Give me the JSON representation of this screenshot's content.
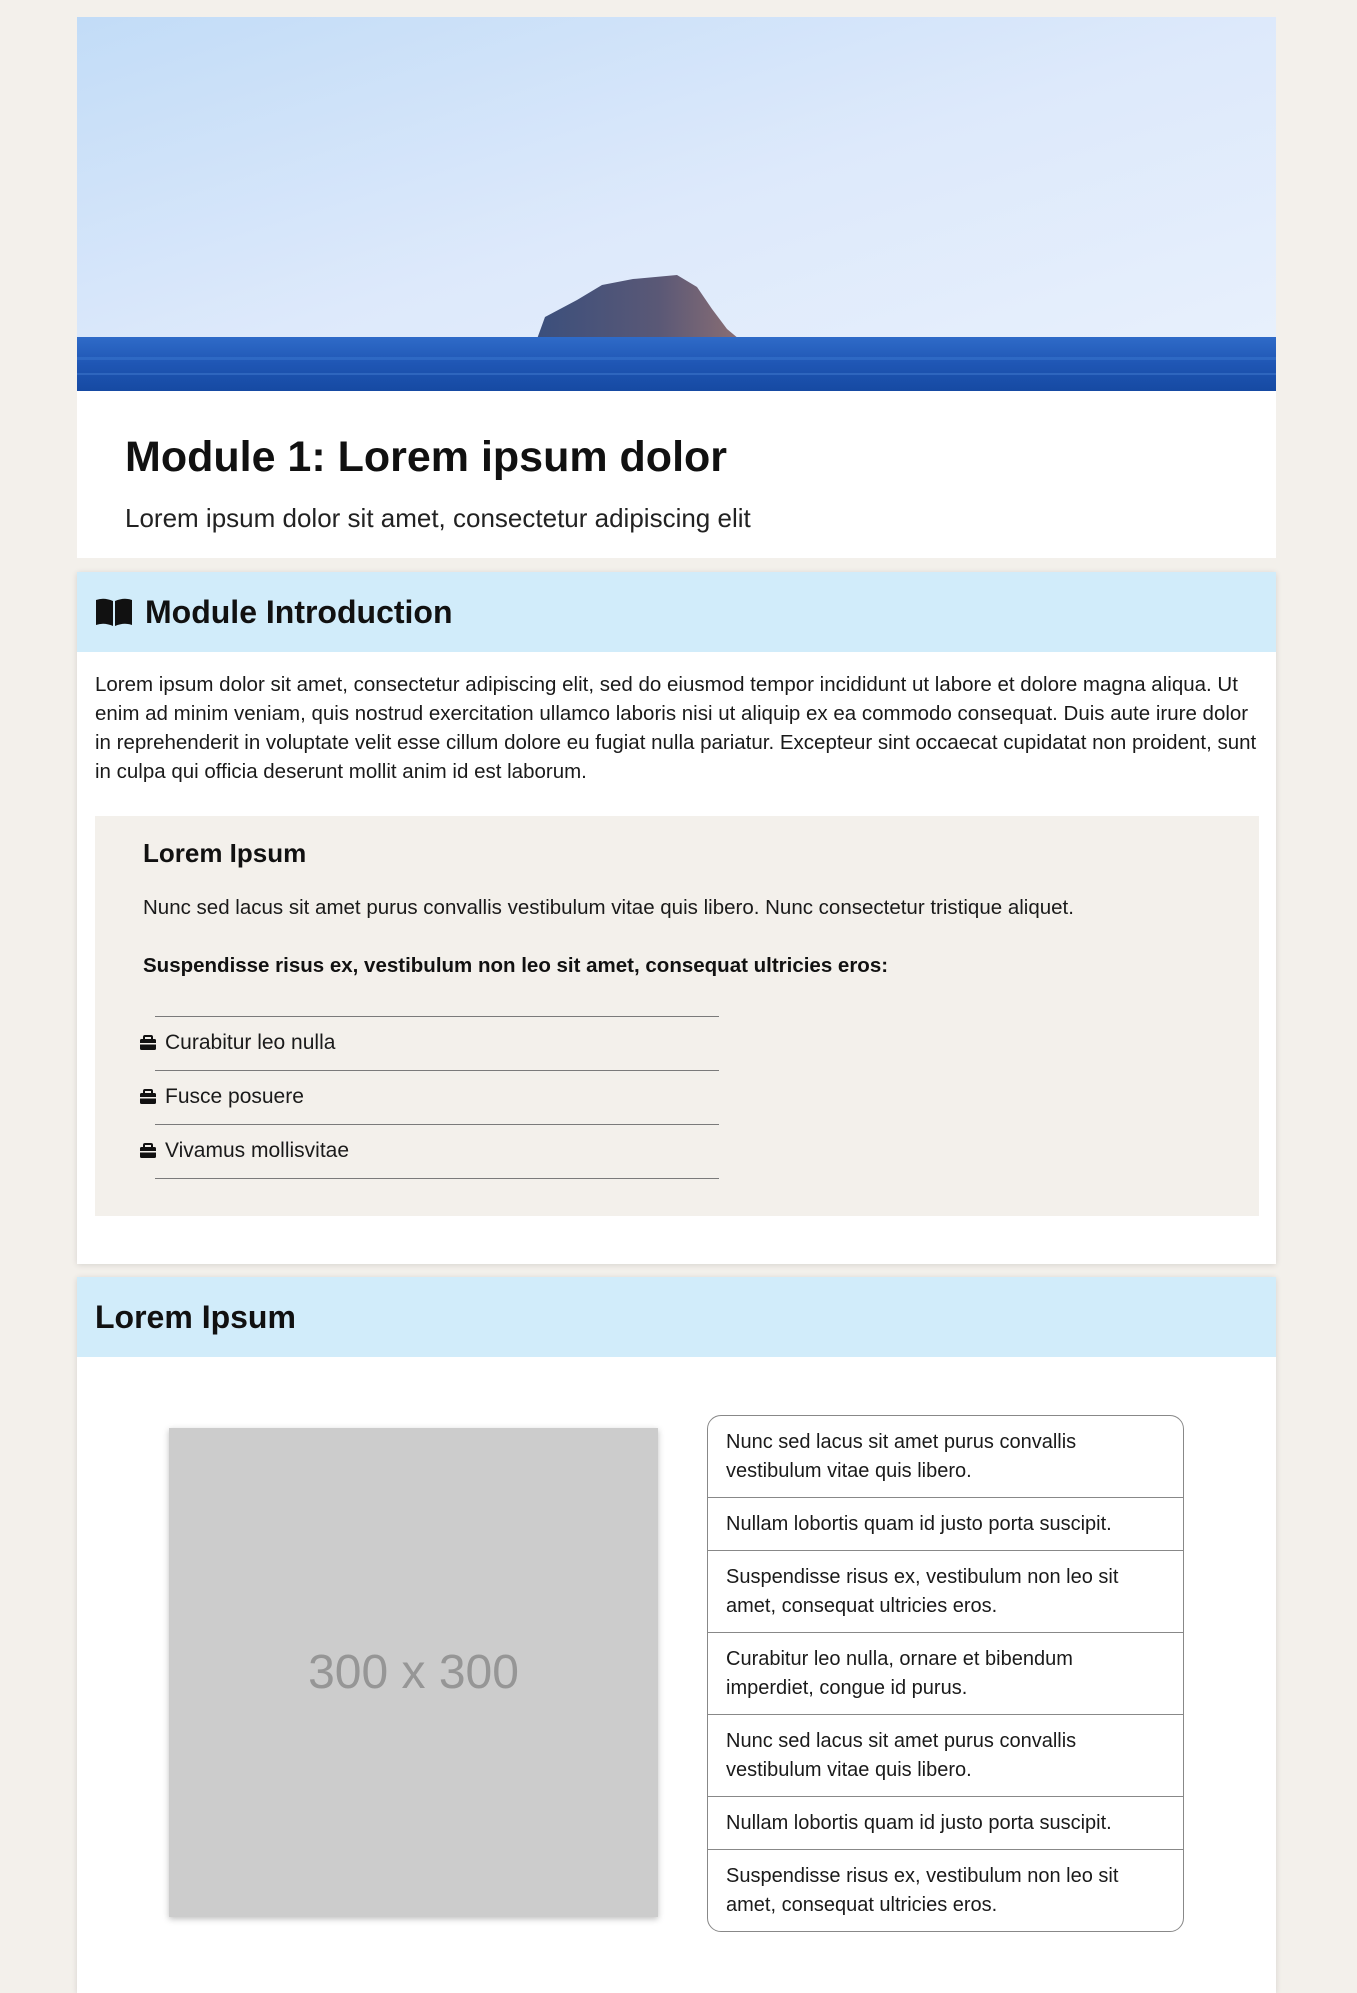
{
  "hero": {
    "title": "Module 1: Lorem ipsum dolor",
    "subtitle": "Lorem ipsum dolor sit amet, consectetur adipiscing elit"
  },
  "intro": {
    "heading": "Module Introduction",
    "heading_icon": "book-open-icon",
    "paragraph": "Lorem ipsum dolor sit amet, consectetur adipiscing elit, sed do eiusmod tempor incididunt ut labore et dolore magna aliqua. Ut enim ad minim veniam, quis nostrud exercitation ullamco laboris nisi ut aliquip ex ea commodo consequat. Duis aute irure dolor in reprehenderit in voluptate velit esse cillum dolore eu fugiat nulla pariatur. Excepteur sint occaecat cupidatat non proident, sunt in culpa qui officia deserunt mollit anim id est laborum.",
    "box": {
      "title": "Lorem Ipsum",
      "text": "Nunc sed lacus sit amet purus convallis vestibulum vitae quis libero. Nunc consectetur tristique aliquet.",
      "bold_text": "Suspendisse risus ex, vestibulum non leo sit amet, consequat ultricies eros:",
      "item_icon": "briefcase-icon",
      "items": [
        "Curabitur leo nulla",
        "Fusce posuere",
        "Vivamus mollisvitae"
      ]
    }
  },
  "lorem": {
    "heading": "Lorem Ipsum",
    "placeholder_text": "300 x 300",
    "list": [
      "Nunc sed lacus sit amet purus convallis vestibulum vitae quis libero.",
      "Nullam lobortis quam id justo porta suscipit.",
      "Suspendisse risus ex, vestibulum non leo sit amet, consequat ultricies eros.",
      "Curabitur leo nulla, ornare et bibendum imperdiet, congue id purus.",
      "Nunc sed lacus sit amet purus convallis vestibulum vitae quis libero.",
      "Nullam lobortis quam id justo porta suscipit.",
      "Suspendisse risus ex, vestibulum non leo sit amet, consequat ultricies eros."
    ]
  },
  "colors": {
    "page_background": "#f3f0eb",
    "header_band": "#d1ecfa",
    "card_background": "#ffffff",
    "placeholder": "#cccccc"
  }
}
